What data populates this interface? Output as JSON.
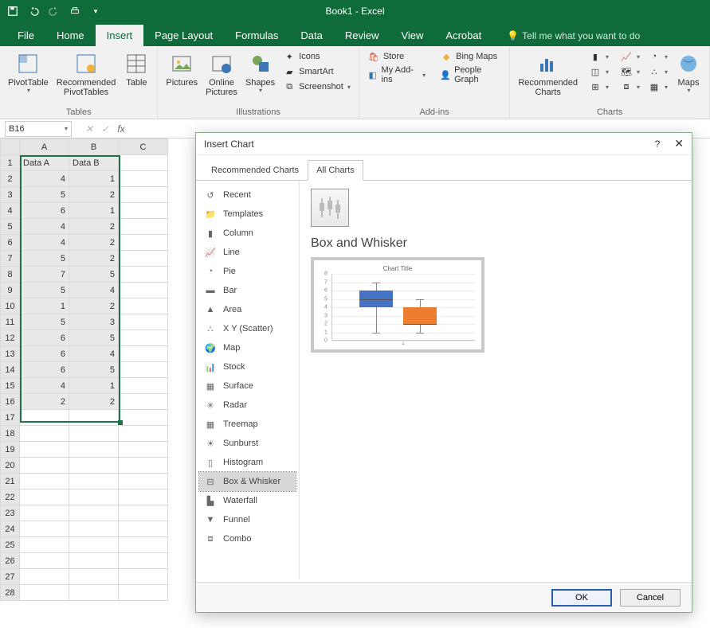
{
  "app": {
    "title": "Book1 - Excel"
  },
  "tabs": [
    "File",
    "Home",
    "Insert",
    "Page Layout",
    "Formulas",
    "Data",
    "Review",
    "View",
    "Acrobat"
  ],
  "tellme": "Tell me what you want to do",
  "ribbon": {
    "tables": {
      "pivot": "PivotTable",
      "recpivot": "Recommended\nPivotTables",
      "table": "Table",
      "group": "Tables"
    },
    "illus": {
      "pictures": "Pictures",
      "online": "Online\nPictures",
      "shapes": "Shapes",
      "icons": "Icons",
      "smartart": "SmartArt",
      "screenshot": "Screenshot",
      "group": "Illustrations"
    },
    "addins": {
      "store": "Store",
      "myaddins": "My Add-ins",
      "bing": "Bing Maps",
      "people": "People Graph",
      "group": "Add-ins"
    },
    "charts": {
      "rec": "Recommended\nCharts",
      "maps": "Maps",
      "pivotc": "P",
      "group": "Charts"
    }
  },
  "namebox": "B16",
  "sheet": {
    "cols": [
      "A",
      "B",
      "C"
    ],
    "headers": [
      "Data A",
      "Data B"
    ],
    "rows": [
      [
        4,
        1
      ],
      [
        5,
        2
      ],
      [
        6,
        1
      ],
      [
        4,
        2
      ],
      [
        4,
        2
      ],
      [
        5,
        2
      ],
      [
        7,
        5
      ],
      [
        5,
        4
      ],
      [
        1,
        2
      ],
      [
        5,
        3
      ],
      [
        6,
        5
      ],
      [
        6,
        4
      ],
      [
        6,
        5
      ],
      [
        4,
        1
      ],
      [
        2,
        2
      ]
    ],
    "extra_rows": 12
  },
  "dialog": {
    "title": "Insert Chart",
    "help": "?",
    "tabs": {
      "rec": "Recommended Charts",
      "all": "All Charts"
    },
    "types": [
      "Recent",
      "Templates",
      "Column",
      "Line",
      "Pie",
      "Bar",
      "Area",
      "X Y (Scatter)",
      "Map",
      "Stock",
      "Surface",
      "Radar",
      "Treemap",
      "Sunburst",
      "Histogram",
      "Box & Whisker",
      "Waterfall",
      "Funnel",
      "Combo"
    ],
    "selected_type": "Box & Whisker",
    "heading": "Box and Whisker",
    "preview_title": "Chart Title",
    "xcat": "1",
    "ok": "OK",
    "cancel": "Cancel"
  },
  "chart_data": {
    "type": "boxplot",
    "title": "Chart Title",
    "ylim": [
      0,
      8
    ],
    "yticks": [
      0,
      1,
      2,
      3,
      4,
      5,
      6,
      7,
      8
    ],
    "categories": [
      "1"
    ],
    "series": [
      {
        "name": "Data A",
        "color": "#4472c4",
        "min": 1,
        "q1": 4,
        "median": 5,
        "q3": 6,
        "max": 7
      },
      {
        "name": "Data B",
        "color": "#ed7d31",
        "min": 1,
        "q1": 2,
        "median": 2,
        "q3": 4,
        "max": 5
      }
    ]
  }
}
